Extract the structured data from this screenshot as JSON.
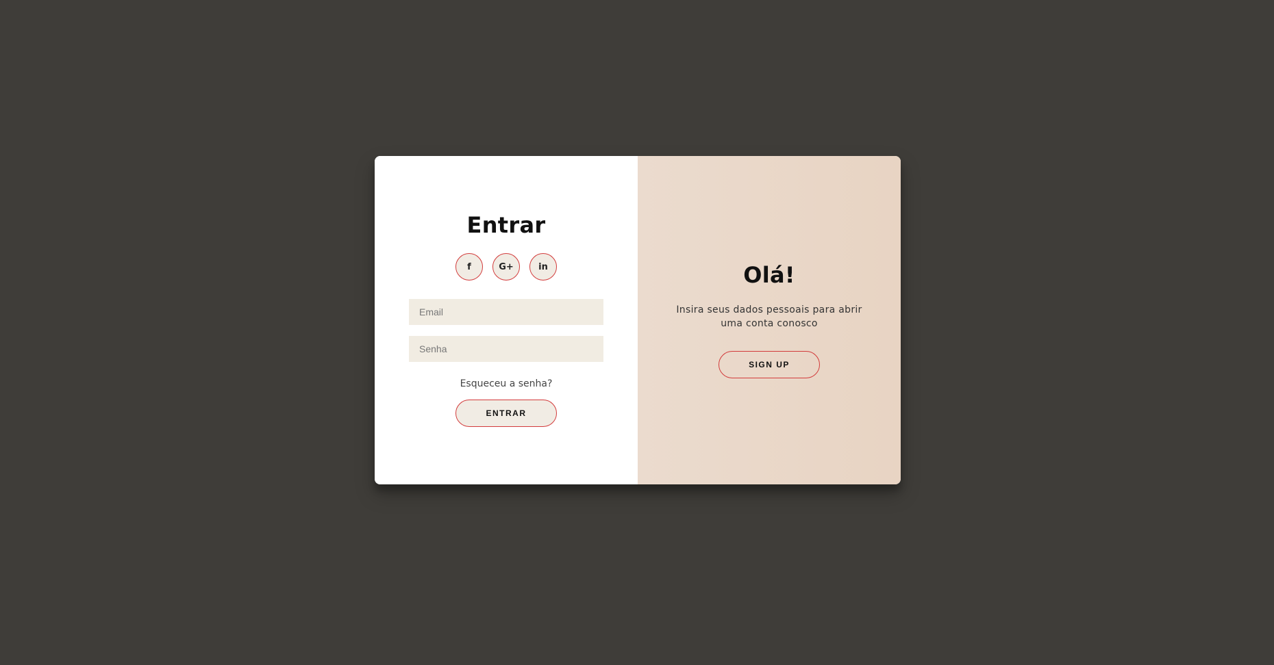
{
  "login": {
    "title": "Entrar",
    "social": [
      {
        "icon": "facebook-icon",
        "glyph": "f"
      },
      {
        "icon": "google-plus-icon",
        "glyph": "G+"
      },
      {
        "icon": "linkedin-icon",
        "glyph": "in"
      }
    ],
    "email_placeholder": "Email",
    "password_placeholder": "Senha",
    "forgot_label": "Esqueceu a senha?",
    "submit_label": "ENTRAR"
  },
  "overlay": {
    "title": "Olá!",
    "subtitle": "Insira seus dados pessoais para abrir uma conta conosco",
    "signup_label": "SIGN UP"
  },
  "colors": {
    "background": "#3f3d39",
    "accent": "#d23a3a",
    "input_bg": "#f1ece2",
    "right_panel": "#ebdbce"
  }
}
